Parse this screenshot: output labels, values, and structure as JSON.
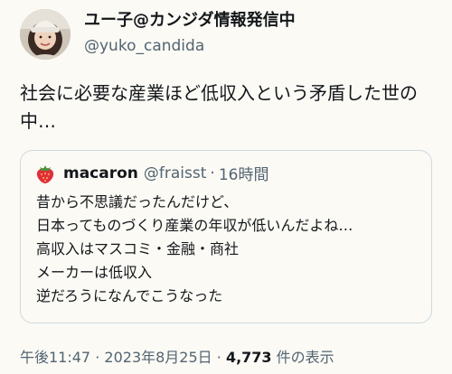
{
  "author": {
    "display_name": "ユー子@カンジダ情報発信中",
    "handle": "@yuko_candida"
  },
  "tweet": {
    "lines": [
      "社会に必要な産業ほど低収入という矛盾した世の",
      "中…"
    ]
  },
  "quote": {
    "name": "macaron",
    "handle": "@fraisst",
    "separator": "·",
    "time": "16時間",
    "lines": [
      "昔から不思議だったんだけど、",
      "日本ってものづくり産業の年収が低いんだよね…",
      "高収入はマスコミ・金融・商社",
      "メーカーは低収入",
      "逆だろうになんでこうなった"
    ]
  },
  "meta": {
    "time": "午後11:47",
    "dot1": "·",
    "date": "2023年8月25日",
    "dot2": "·",
    "views_count": "4,773",
    "views_label": "件の表示"
  },
  "colors": {
    "background": "#fbfaf5",
    "text_primary": "#14171a",
    "text_secondary": "#536471",
    "border": "#cfd9de"
  },
  "icons": {
    "quote_avatar": "strawberry-icon"
  }
}
